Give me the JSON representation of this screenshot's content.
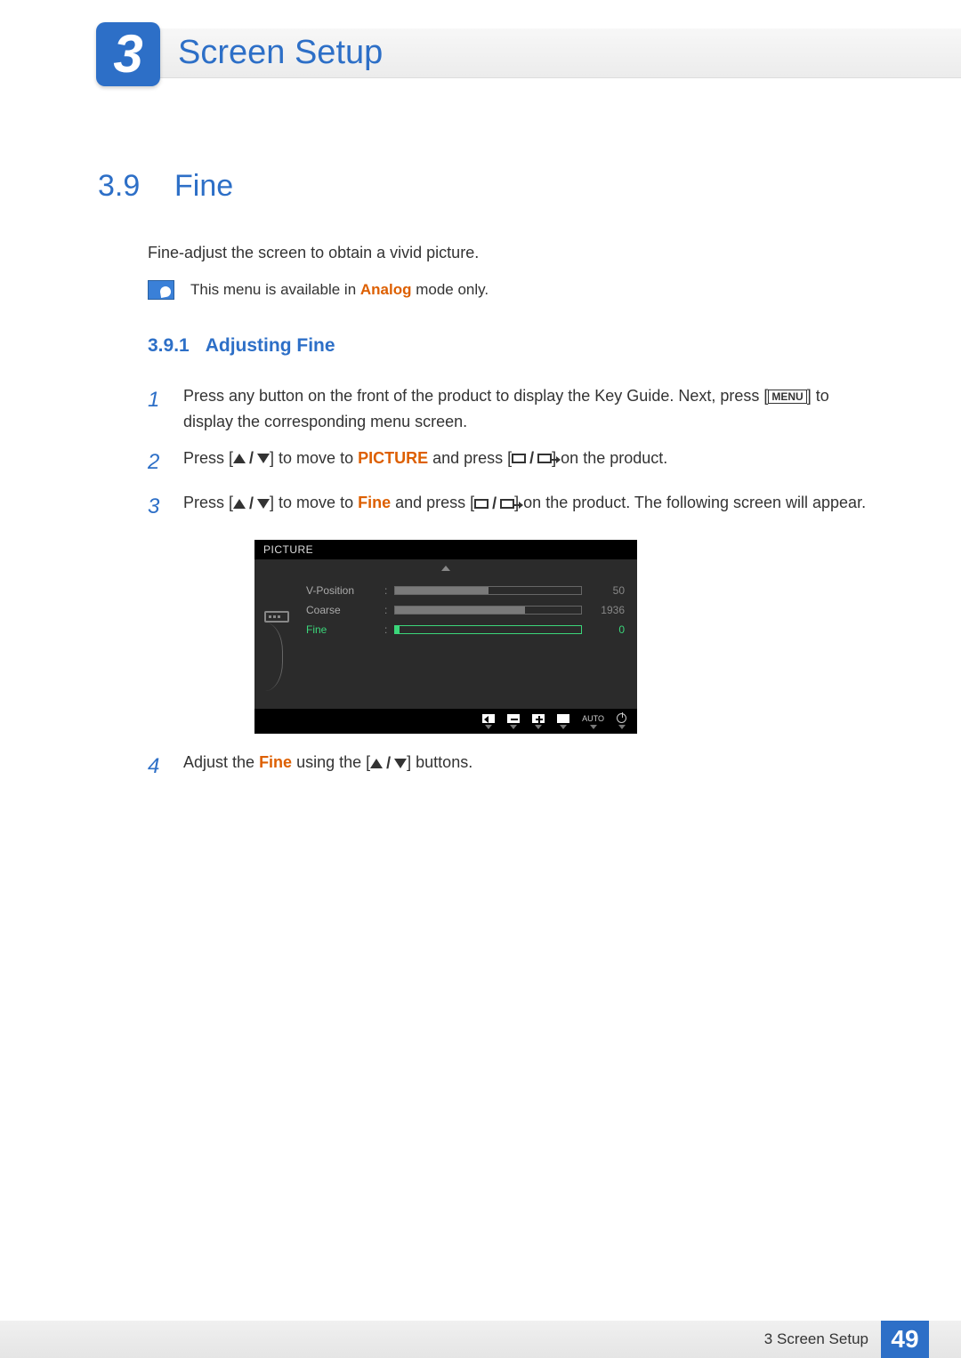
{
  "chapter": {
    "number": "3",
    "title": "Screen Setup"
  },
  "section": {
    "number": "3.9",
    "title": "Fine"
  },
  "intro": "Fine-adjust the screen to obtain a vivid picture.",
  "note": {
    "prefix": "This menu is available in ",
    "highlight": "Analog",
    "suffix": " mode only."
  },
  "subsection": {
    "number": "3.9.1",
    "title": "Adjusting Fine"
  },
  "steps": {
    "s1": {
      "num": "1",
      "a": "Press any button on the front of the product to display the Key Guide. Next, press [",
      "menu": "MENU",
      "b": "] to display the corresponding menu screen."
    },
    "s2": {
      "num": "2",
      "a": "Press [",
      "b": "] to move to ",
      "hl": "PICTURE",
      "c": " and press [",
      "d": "] on the product."
    },
    "s3": {
      "num": "3",
      "a": "Press [",
      "b": "] to move to ",
      "hl": "Fine",
      "c": " and press [",
      "d": "] on the product. The following screen will appear."
    },
    "s4": {
      "num": "4",
      "a": "Adjust the ",
      "hl": "Fine",
      "b": " using the [",
      "c": "] buttons."
    }
  },
  "osd": {
    "title": "PICTURE",
    "rows": [
      {
        "label": "V-Position",
        "value": "50",
        "fill": 50,
        "active": false
      },
      {
        "label": "Coarse",
        "value": "1936",
        "fill": 70,
        "active": false
      },
      {
        "label": "Fine",
        "value": "0",
        "fill": 2,
        "active": true
      }
    ],
    "footer_auto": "AUTO"
  },
  "footer": {
    "text": "3 Screen Setup",
    "page": "49"
  }
}
